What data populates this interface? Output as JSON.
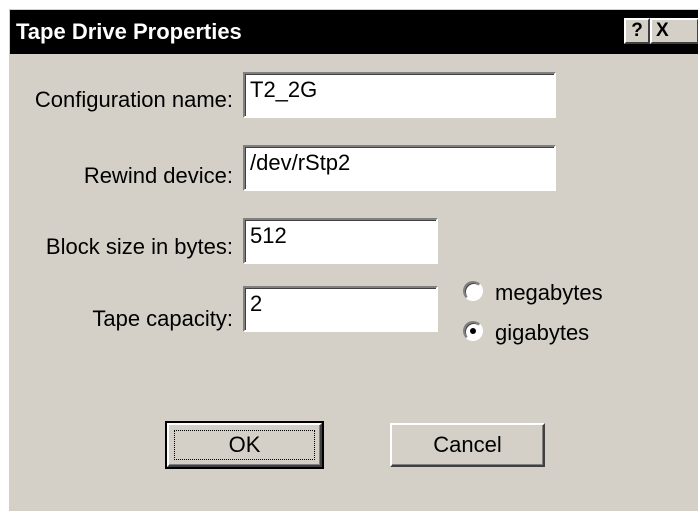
{
  "window": {
    "title": "Tape Drive Properties",
    "help_label": "?",
    "close_label": "X"
  },
  "form": {
    "config_name": {
      "label": "Configuration name:",
      "value": "T2_2G"
    },
    "rewind_device": {
      "label": "Rewind device:",
      "value": "/dev/rStp2"
    },
    "block_size": {
      "label": "Block size in bytes:",
      "value": "512"
    },
    "tape_capacity": {
      "label": "Tape capacity:",
      "value": "2"
    },
    "units": {
      "options": [
        "megabytes",
        "gigabytes"
      ],
      "selected": "gigabytes"
    }
  },
  "buttons": {
    "ok_label": "OK",
    "cancel_label": "Cancel"
  },
  "colors": {
    "title_bar": "#000000",
    "dialog_face": "#d4d0c8",
    "field_bg": "#ffffff"
  }
}
